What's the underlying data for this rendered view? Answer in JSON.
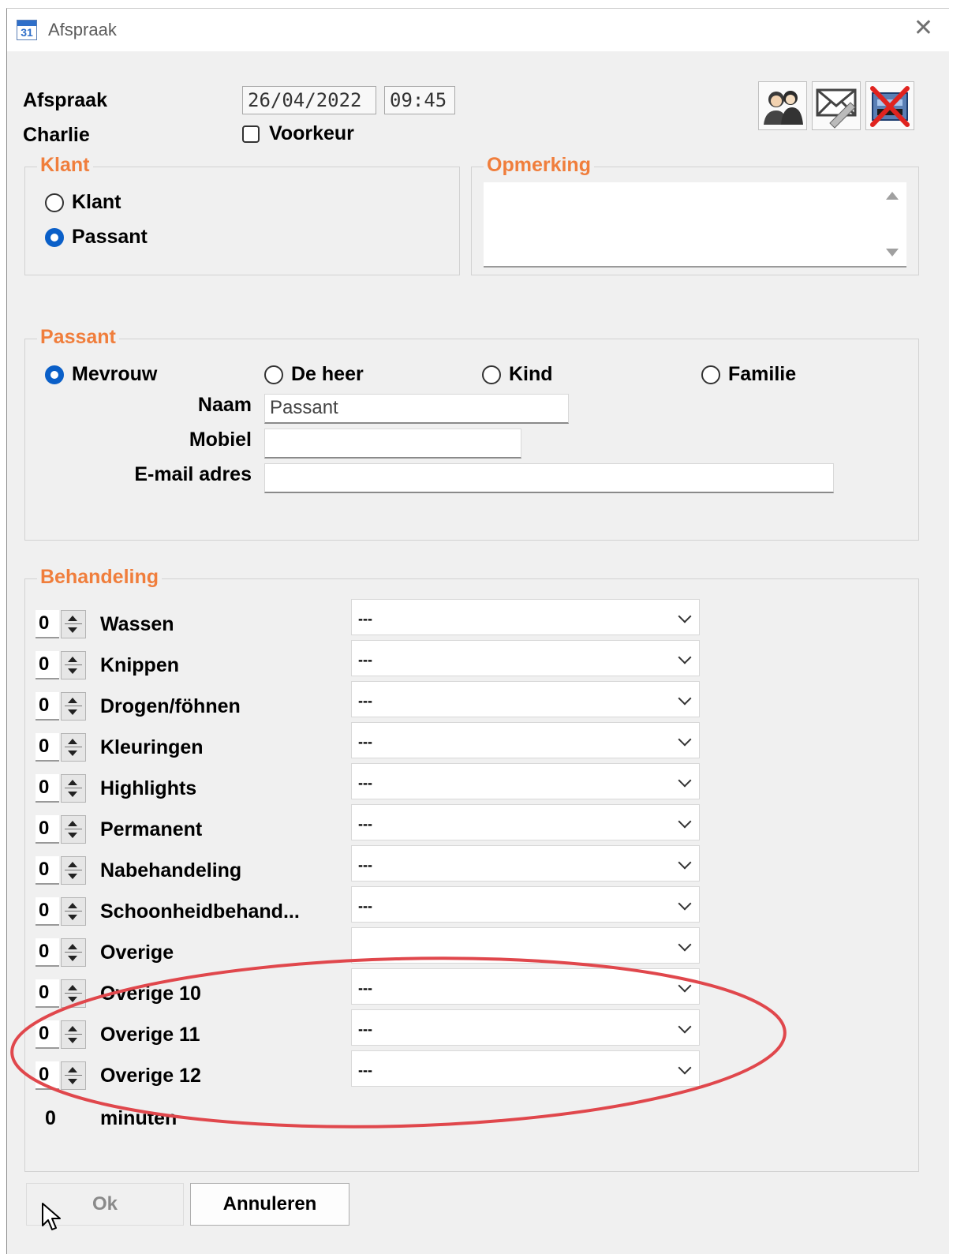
{
  "window": {
    "title": "Afspraak",
    "icon_day": "31"
  },
  "header": {
    "label_afspraak": "Afspraak",
    "label_name": "Charlie",
    "date": "26/04/2022",
    "time": "09:45",
    "voorkeur_label": "Voorkeur"
  },
  "klant_group": {
    "legend": "Klant",
    "options": [
      {
        "label": "Klant",
        "selected": false
      },
      {
        "label": "Passant",
        "selected": true
      }
    ]
  },
  "opmerking_group": {
    "legend": "Opmerking"
  },
  "passant_group": {
    "legend": "Passant",
    "options": [
      {
        "label": "Mevrouw",
        "selected": true
      },
      {
        "label": "De heer",
        "selected": false
      },
      {
        "label": "Kind",
        "selected": false
      },
      {
        "label": "Familie",
        "selected": false
      }
    ],
    "naam_label": "Naam",
    "naam_value": "Passant",
    "mobiel_label": "Mobiel",
    "mobiel_value": "",
    "email_label": "E-mail adres",
    "email_value": ""
  },
  "behandeling_group": {
    "legend": "Behandeling",
    "rows": [
      {
        "count": "0",
        "label": "Wassen",
        "select": "---"
      },
      {
        "count": "0",
        "label": "Knippen",
        "select": "---"
      },
      {
        "count": "0",
        "label": "Drogen/föhnen",
        "select": "---"
      },
      {
        "count": "0",
        "label": "Kleuringen",
        "select": "---"
      },
      {
        "count": "0",
        "label": "Highlights",
        "select": "---"
      },
      {
        "count": "0",
        "label": "Permanent",
        "select": "---"
      },
      {
        "count": "0",
        "label": "Nabehandeling",
        "select": "---"
      },
      {
        "count": "0",
        "label": "Schoonheidbehand...",
        "select": "---"
      },
      {
        "count": "0",
        "label": "Overige",
        "select": ""
      },
      {
        "count": "0",
        "label": "Overige 10",
        "select": "---"
      },
      {
        "count": "0",
        "label": "Overige 11",
        "select": "---"
      },
      {
        "count": "0",
        "label": "Overige 12",
        "select": "---"
      }
    ],
    "total_value": "0",
    "total_unit": "minuten"
  },
  "buttons": {
    "ok": "Ok",
    "cancel": "Annuleren"
  },
  "colors": {
    "accent": "#f07e3c",
    "radio_selected": "#0a5fc8",
    "annotation": "#e0474c"
  }
}
